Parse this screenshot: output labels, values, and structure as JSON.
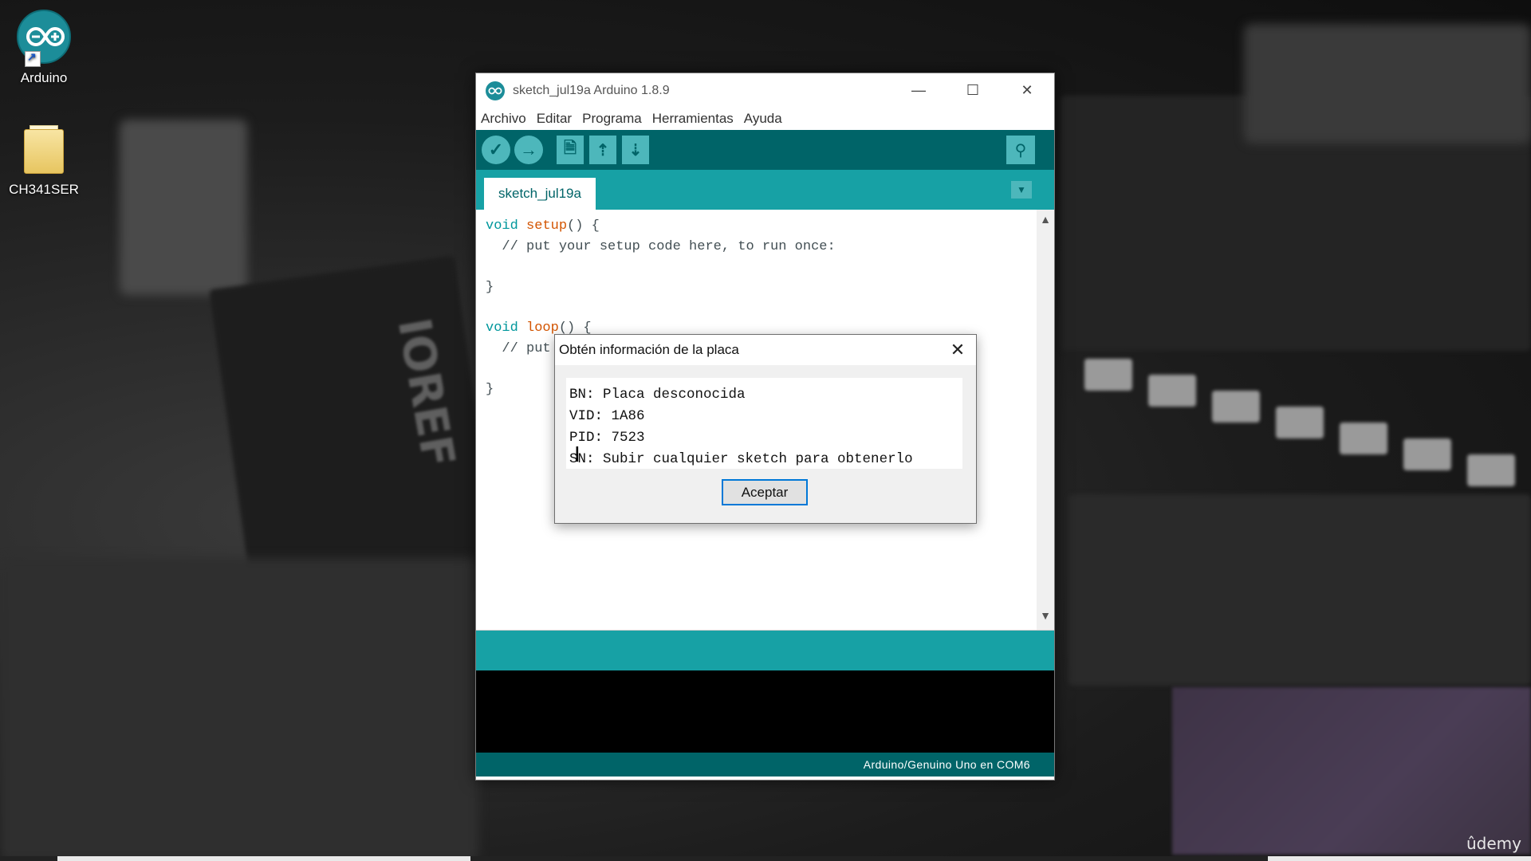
{
  "desktop": {
    "icons": [
      {
        "label": "Arduino"
      },
      {
        "label": "CH341SER"
      }
    ]
  },
  "window": {
    "title": "sketch_jul19a Arduino 1.8.9",
    "controls": {
      "minimize": "—",
      "maximize": "☐",
      "close": "✕"
    },
    "menu": [
      "Archivo",
      "Editar",
      "Programa",
      "Herramientas",
      "Ayuda"
    ],
    "toolbar": {
      "verify": "✓",
      "upload": "→",
      "new": "🗎",
      "open": "⇡",
      "save": "⇣",
      "serial_monitor": "⚲"
    },
    "tab": {
      "label": "sketch_jul19a",
      "menu_icon": "▼"
    },
    "code": {
      "line1_kw": "void",
      "line1_fn": "setup",
      "line1_rest": "() {",
      "line2": "  // put your setup code here, to run once:",
      "line4": "}",
      "line6_kw": "void",
      "line6_fn": "loop",
      "line6_rest": "() {",
      "line7": "  // put",
      "line9": "}"
    },
    "status_board": "Arduino/Genuino Uno en COM6"
  },
  "dialog": {
    "title": "Obtén información de la placa",
    "close": "✕",
    "lines": [
      "BN: Placa desconocida",
      "VID: 1A86",
      "PID: 7523",
      "SN: Subir cualquier sketch para obtenerlo"
    ],
    "ok_label": "Aceptar"
  },
  "watermark": "ûdemy",
  "colors": {
    "toolbar": "#006468",
    "tabbar": "#17a1a5",
    "button": "#4db7bb",
    "keyword": "#00979c",
    "function": "#d35400"
  }
}
